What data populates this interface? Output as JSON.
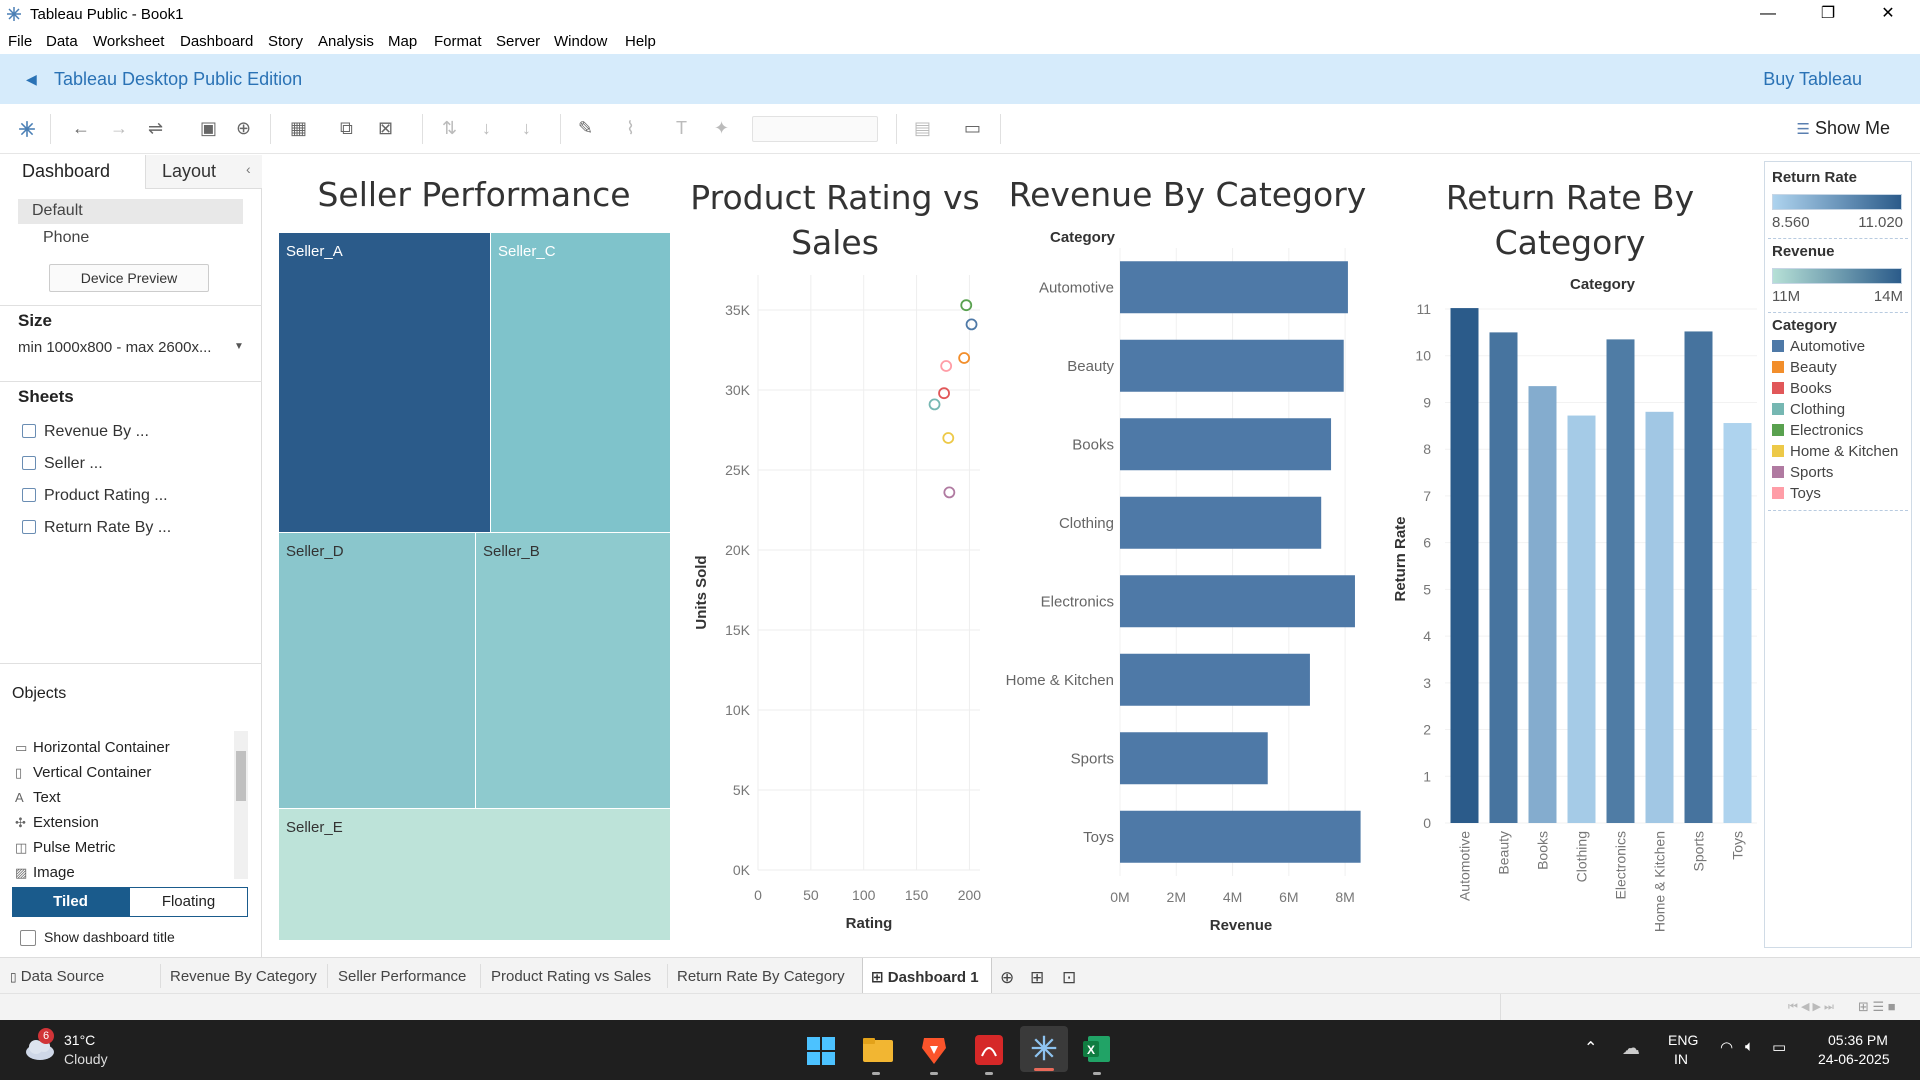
{
  "window": {
    "title": "Tableau Public - Book1",
    "minimize": "—",
    "restore": "❐",
    "close": "✕"
  },
  "menu": [
    "File",
    "Data",
    "Worksheet",
    "Dashboard",
    "Story",
    "Analysis",
    "Map",
    "Format",
    "Server",
    "Window",
    "Help"
  ],
  "banner": {
    "edition": "Tableau Desktop Public Edition",
    "buy": "Buy Tableau"
  },
  "toolbar": {
    "show_me": "Show Me"
  },
  "left_pane": {
    "tabs": [
      "Dashboard",
      "Layout"
    ],
    "device": {
      "default": "Default",
      "phone": "Phone",
      "preview_button": "Device Preview"
    },
    "size": {
      "title": "Size",
      "value": "min 1000x800 - max 2600x..."
    },
    "sheets": {
      "title": "Sheets",
      "items": [
        "Revenue By ...",
        "Seller ...",
        "Product Rating ...",
        "Return Rate By ..."
      ]
    },
    "objects": {
      "title": "Objects",
      "items": [
        "Horizontal Container",
        "Vertical Container",
        "Text",
        "Extension",
        "Pulse Metric",
        "Image"
      ],
      "tiled": "Tiled",
      "floating": "Floating",
      "show_title": "Show dashboard title"
    }
  },
  "dashboard": {
    "seller": {
      "title": "Seller Performance",
      "sellers": [
        "Seller_A",
        "Seller_C",
        "Seller_D",
        "Seller_B",
        "Seller_E"
      ]
    },
    "scatter": {
      "title_l1": "Product Rating vs",
      "title_l2": "Sales"
    },
    "revenue": {
      "title": "Revenue By Category",
      "column_header": "Category"
    },
    "return": {
      "title_l1": "Return Rate By",
      "title_l2": "Category",
      "column_header": "Category"
    }
  },
  "chart_data": [
    {
      "type": "scatter",
      "title": "Product Rating vs Sales",
      "xlabel": "Rating",
      "ylabel": "Units Sold",
      "xlim": [
        0,
        210
      ],
      "ylim": [
        0,
        35000
      ],
      "xticks": [
        "0",
        "50",
        "100",
        "150",
        "200"
      ],
      "yticks": [
        "0K",
        "5K",
        "10K",
        "15K",
        "20K",
        "25K",
        "30K",
        "35K"
      ],
      "points": [
        {
          "category": "Automotive",
          "x": 202,
          "y": 34100,
          "color": "#4e79a7"
        },
        {
          "category": "Beauty",
          "x": 195,
          "y": 32000,
          "color": "#f28e2b"
        },
        {
          "category": "Books",
          "x": 176,
          "y": 29800,
          "color": "#e15759"
        },
        {
          "category": "Clothing",
          "x": 167,
          "y": 29100,
          "color": "#76b7b2"
        },
        {
          "category": "Electronics",
          "x": 197,
          "y": 35300,
          "color": "#59a14f"
        },
        {
          "category": "Home & Kitchen",
          "x": 180,
          "y": 27000,
          "color": "#edc948"
        },
        {
          "category": "Sports",
          "x": 181,
          "y": 23600,
          "color": "#b07aa1"
        },
        {
          "category": "Toys",
          "x": 178,
          "y": 31500,
          "color": "#ff9da7"
        }
      ]
    },
    {
      "type": "bar",
      "orientation": "horizontal",
      "title": "Revenue By Category",
      "xlabel": "Revenue",
      "ylabel": "Category",
      "xlim": [
        0,
        8600000
      ],
      "xticks": [
        "0M",
        "2M",
        "4M",
        "6M",
        "8M"
      ],
      "categories": [
        "Automotive",
        "Beauty",
        "Books",
        "Clothing",
        "Electronics",
        "Home & Kitchen",
        "Sports",
        "Toys"
      ],
      "values": [
        8100000,
        7950000,
        7500000,
        7150000,
        8350000,
        6750000,
        5250000,
        8550000
      ],
      "color": "#4e79a7"
    },
    {
      "type": "bar",
      "orientation": "vertical",
      "title": "Return Rate By Category",
      "xlabel": "Category",
      "ylabel": "Return Rate",
      "ylim": [
        0,
        11.3
      ],
      "yticks": [
        "0",
        "1",
        "2",
        "3",
        "4",
        "5",
        "6",
        "7",
        "8",
        "9",
        "10",
        "11"
      ],
      "categories": [
        "Automotive",
        "Beauty",
        "Books",
        "Clothing",
        "Electronics",
        "Home & Kitchen",
        "Sports",
        "Toys"
      ],
      "values": [
        11.02,
        10.5,
        9.35,
        8.72,
        10.35,
        8.8,
        10.52,
        8.56
      ],
      "color_scale": [
        "#aed3ee",
        "#2b5b8a"
      ]
    },
    {
      "type": "treemap",
      "title": "Seller Performance",
      "categories": [
        "Seller_A",
        "Seller_C",
        "Seller_D",
        "Seller_B",
        "Seller_E"
      ]
    }
  ],
  "legends": {
    "return_rate": {
      "title": "Return Rate",
      "min": "8.560",
      "max": "11.020"
    },
    "revenue": {
      "title": "Revenue",
      "min": "11M",
      "max": "14M"
    },
    "category": {
      "title": "Category",
      "items": [
        {
          "label": "Automotive",
          "color": "#4e79a7"
        },
        {
          "label": "Beauty",
          "color": "#f28e2b"
        },
        {
          "label": "Books",
          "color": "#e15759"
        },
        {
          "label": "Clothing",
          "color": "#76b7b2"
        },
        {
          "label": "Electronics",
          "color": "#59a14f"
        },
        {
          "label": "Home & Kitchen",
          "color": "#edc948"
        },
        {
          "label": "Sports",
          "color": "#b07aa1"
        },
        {
          "label": "Toys",
          "color": "#ff9da7"
        }
      ]
    }
  },
  "bottom_tabs": [
    "Data Source",
    "Revenue By Category",
    "Seller Performance",
    "Product Rating vs Sales",
    "Return Rate By Category",
    "Dashboard 1"
  ],
  "taskbar": {
    "weather": {
      "temp": "31°C",
      "condition": "Cloudy",
      "badge": "6"
    },
    "lang": {
      "l1": "ENG",
      "l2": "IN"
    },
    "time": "05:36 PM",
    "date": "24-06-2025"
  }
}
